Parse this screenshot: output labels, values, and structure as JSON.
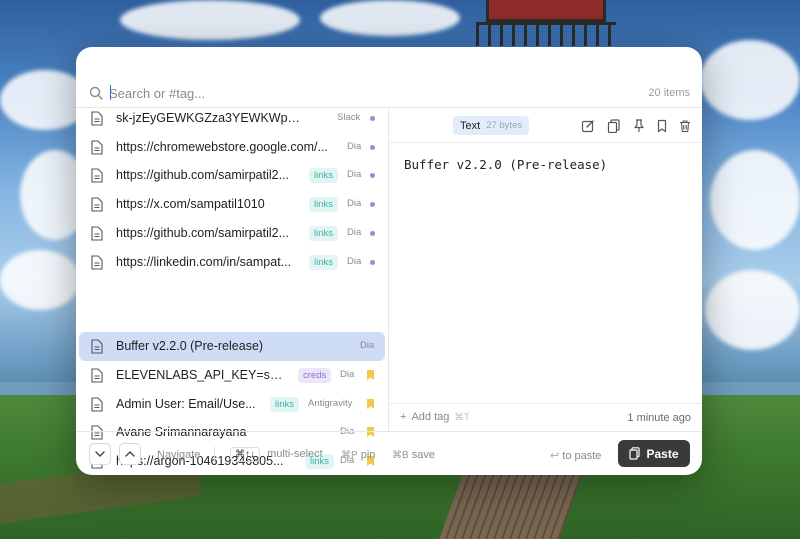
{
  "search": {
    "placeholder": "Search or #tag...",
    "count": "20 items"
  },
  "items": [
    {
      "text": "sk-jzEyGEWKGZza3YEWKWp6051...",
      "tag": "",
      "source": "Slack",
      "marker": "dot"
    },
    {
      "text": "https://chromewebstore.google.com/...",
      "tag": "",
      "source": "Dia",
      "marker": "dot"
    },
    {
      "text": "https://github.com/samirpatil2...",
      "tag": "links",
      "source": "Dia",
      "marker": "dot"
    },
    {
      "text": "https://x.com/sampatil1010",
      "tag": "links",
      "source": "Dia",
      "marker": "dot"
    },
    {
      "text": "https://github.com/samirpatil2...",
      "tag": "links",
      "source": "Dia",
      "marker": "dot"
    },
    {
      "text": "https://linkedin.com/in/sampat...",
      "tag": "links",
      "source": "Dia",
      "marker": "dot"
    },
    {
      "text": "Buffer v2.2.0 (Pre-release)",
      "tag": "",
      "source": "Dia",
      "marker": "none"
    },
    {
      "text": "ELEVENLABS_API_KEY=sk_...",
      "tag": "creds",
      "source": "Dia",
      "marker": "bookmark"
    },
    {
      "text": "Admin User: Email/Use...",
      "tag": "links",
      "source": "Antigravity",
      "marker": "bookmark"
    },
    {
      "text": "Avane Srimannarayana",
      "tag": "",
      "source": "Dia",
      "marker": "bookmark"
    },
    {
      "text": "https://argon-104619346805...",
      "tag": "links",
      "source": "Dia",
      "marker": "bookmark"
    }
  ],
  "preview": {
    "type": "Text",
    "size": "27 bytes",
    "content": "Buffer v2.2.0 (Pre-release)",
    "add_tag": "Add tag",
    "add_tag_shortcut": "⌘T",
    "time": "1 minute ago"
  },
  "footer": {
    "navigate": "Navigate",
    "multi_key": "⌘↑↓",
    "multi": "multi-select",
    "pin_key": "⌘P",
    "pin": "pin",
    "save_key": "⌘B",
    "save": "save",
    "to_paste": "to paste",
    "paste": "Paste"
  },
  "colors": {
    "selected_row": "#cfdcf5",
    "links_tag": "#3bb3a6",
    "creds_tag": "#8d6fd6",
    "dot": "#9a8cd6",
    "bookmark": "#f2c94c",
    "paste_button": "#3a3a3a"
  }
}
